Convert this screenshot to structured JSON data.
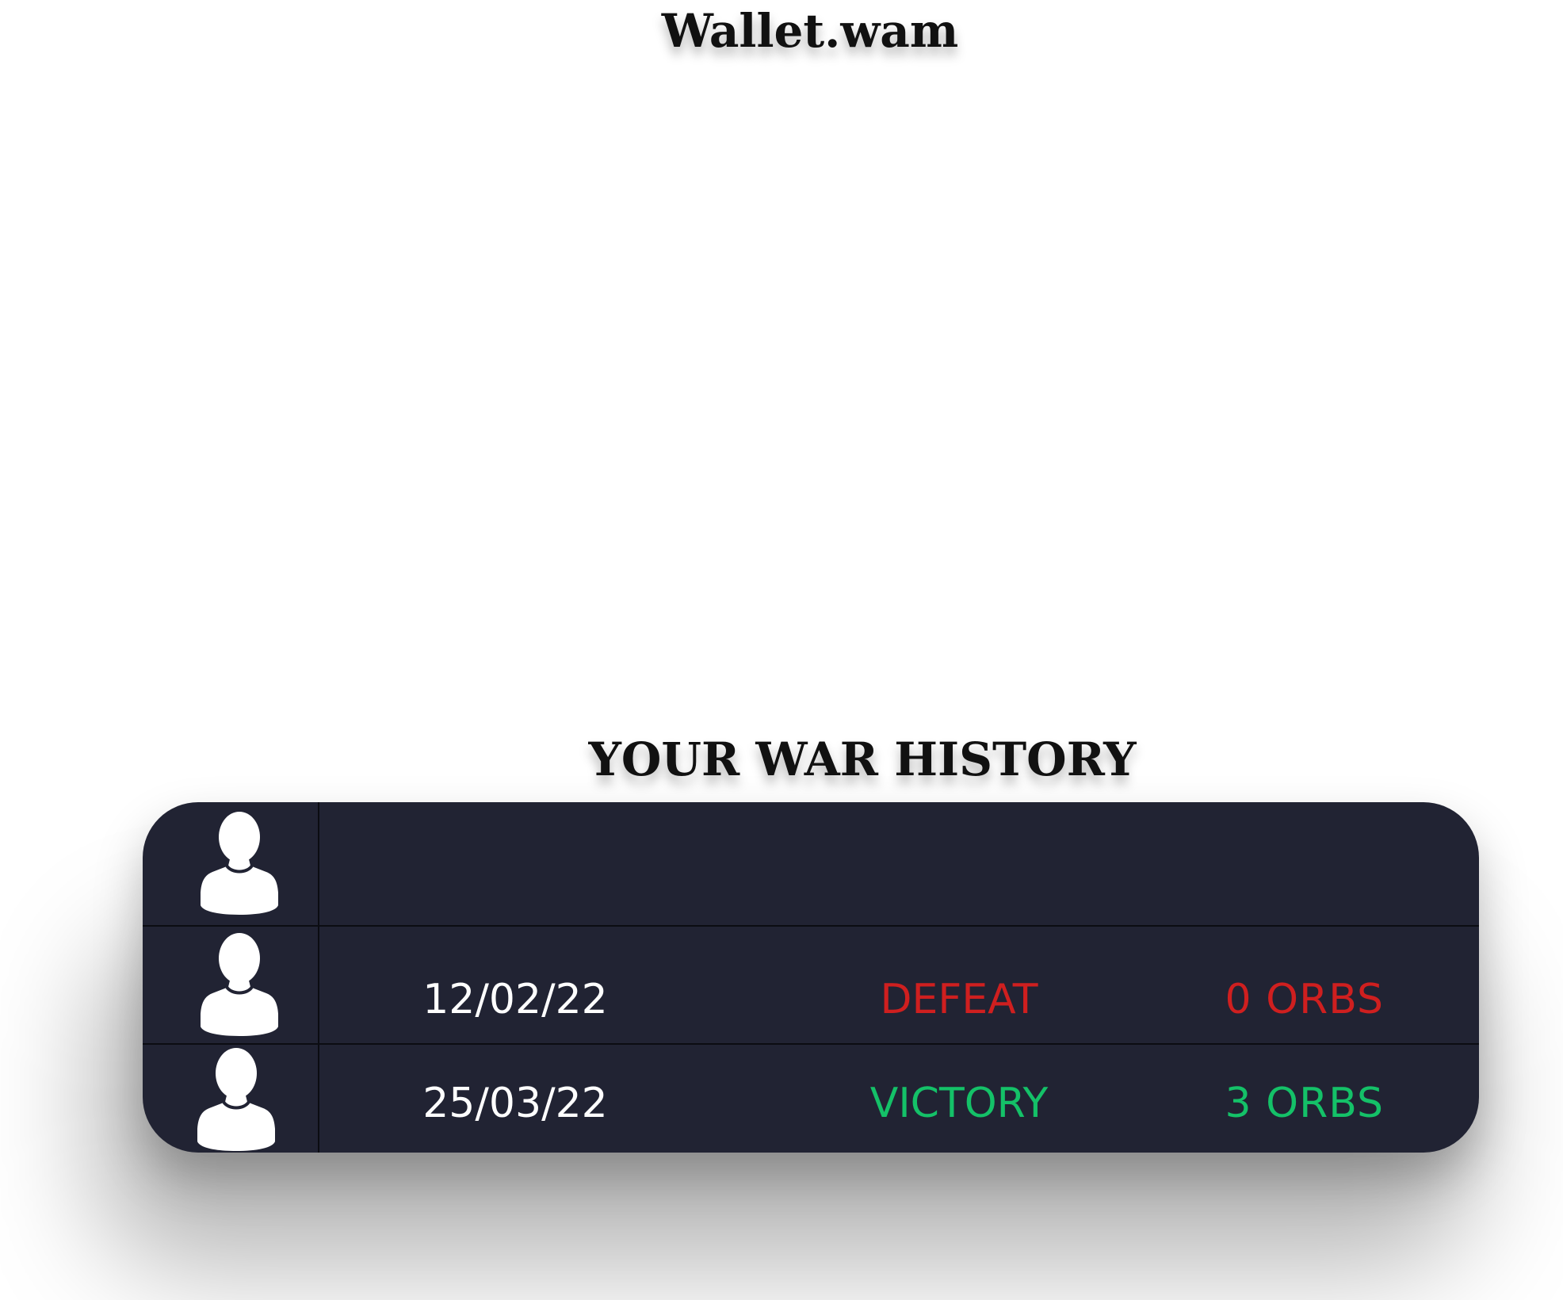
{
  "app": {
    "title": "Wallet.wam"
  },
  "history": {
    "title": "YOUR WAR HISTORY",
    "rows": [
      {
        "avatar_icon": "user-silhouette-icon",
        "date": "",
        "result": "",
        "orbs": ""
      },
      {
        "avatar_icon": "user-silhouette-icon",
        "date": "12/02/22",
        "result": "DEFEAT",
        "orbs": "0 ORBS",
        "status_color": "#cf1f1f"
      },
      {
        "avatar_icon": "user-silhouette-icon",
        "date": "25/03/22",
        "result": "VICTORY",
        "orbs": "3 ORBS",
        "status_color": "#14c168"
      }
    ]
  },
  "colors": {
    "card_background": "#212333",
    "defeat": "#cf1f1f",
    "victory": "#14c168",
    "text_light": "#ffffff",
    "title_text": "#111111"
  }
}
